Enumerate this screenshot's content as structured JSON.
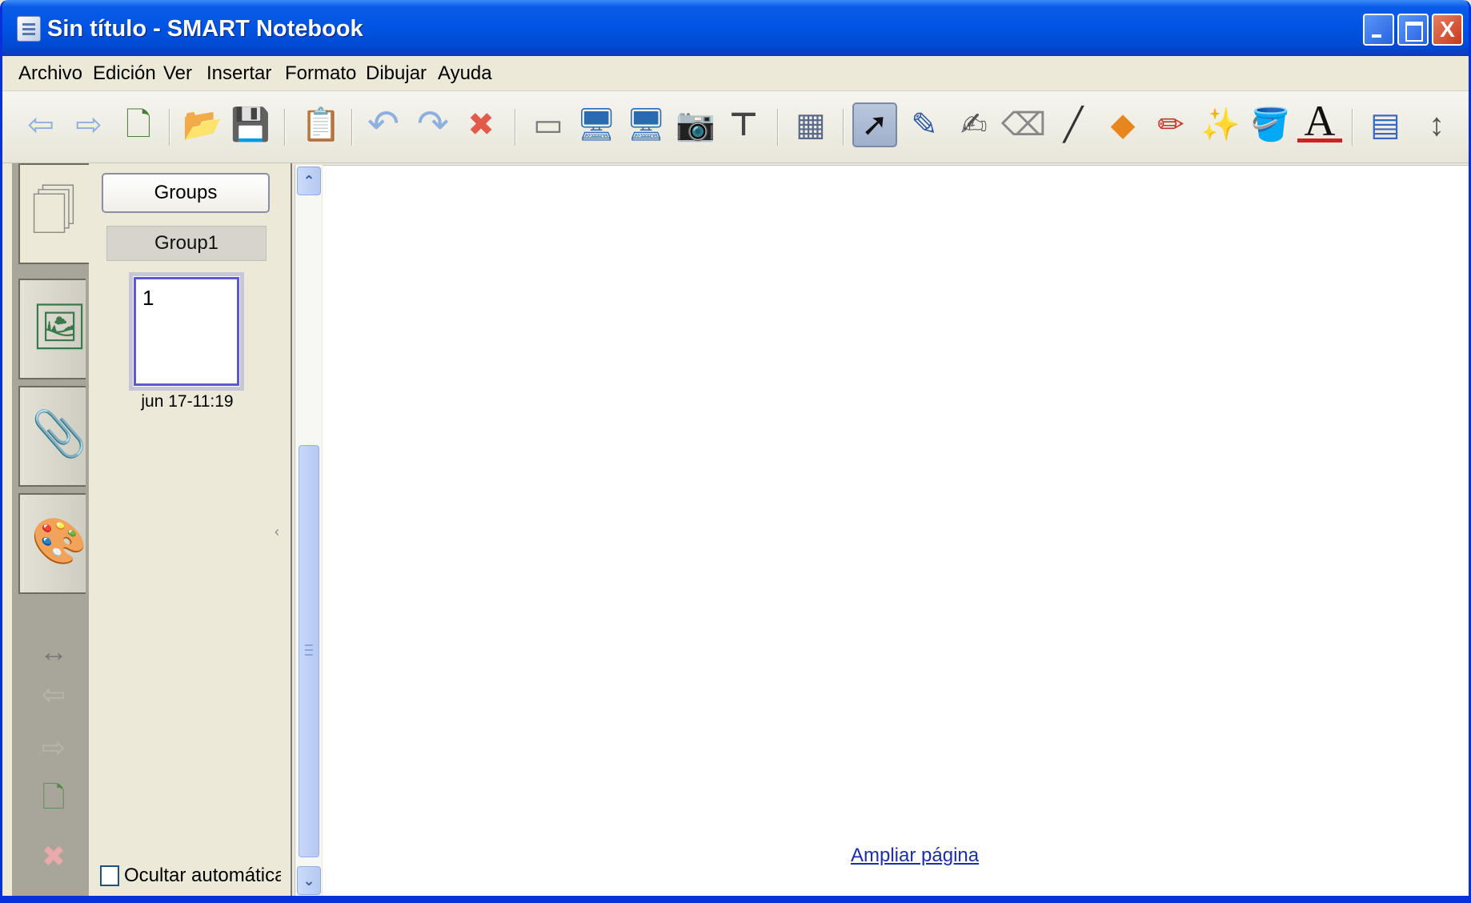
{
  "window": {
    "title": "Sin título - SMART Notebook",
    "controls": {
      "minimize": "minimize",
      "maximize": "maximize",
      "close": "X"
    }
  },
  "menu": {
    "items": [
      "Archivo",
      "Edición",
      "Ver",
      "Insertar",
      "Formato",
      "Dibujar",
      "Ayuda"
    ]
  },
  "toolbar": {
    "tools": [
      {
        "name": "back-arrow-icon",
        "glyph": "⇦"
      },
      {
        "name": "forward-arrow-icon",
        "glyph": "⇨"
      },
      {
        "name": "new-page-icon",
        "glyph": "🗋"
      },
      {
        "name": "open-folder-icon",
        "glyph": "📂"
      },
      {
        "name": "save-icon",
        "glyph": "💾"
      },
      {
        "name": "paste-icon",
        "glyph": "📋"
      },
      {
        "name": "undo-icon",
        "glyph": "↶"
      },
      {
        "name": "redo-icon",
        "glyph": "↷"
      },
      {
        "name": "delete-icon",
        "glyph": "✖"
      },
      {
        "name": "screen-shade-icon",
        "glyph": "▭"
      },
      {
        "name": "full-screen-icon",
        "glyph": "🖥"
      },
      {
        "name": "dual-page-icon",
        "glyph": "🖥"
      },
      {
        "name": "screen-capture-icon",
        "glyph": "📷"
      },
      {
        "name": "document-camera-icon",
        "glyph": "⊤"
      },
      {
        "name": "table-icon",
        "glyph": "▦"
      },
      {
        "name": "select-pointer-icon",
        "glyph": "➚"
      },
      {
        "name": "pen-icon",
        "glyph": "✎"
      },
      {
        "name": "creative-pen-icon",
        "glyph": "✍"
      },
      {
        "name": "eraser-icon",
        "glyph": "⌫"
      },
      {
        "name": "line-icon",
        "glyph": "╱"
      },
      {
        "name": "shapes-icon",
        "glyph": "◆"
      },
      {
        "name": "shape-recognition-pen-icon",
        "glyph": "✏"
      },
      {
        "name": "magic-pen-icon",
        "glyph": "✨"
      },
      {
        "name": "fill-icon",
        "glyph": "🪣"
      },
      {
        "name": "text-icon",
        "glyph": "A"
      },
      {
        "name": "properties-icon",
        "glyph": "▤"
      },
      {
        "name": "move-toolbar-icon",
        "glyph": "↕"
      }
    ]
  },
  "sidebar": {
    "tabs": [
      {
        "name": "page-sorter-tab",
        "glyph": "🗍"
      },
      {
        "name": "gallery-tab",
        "glyph": "🖼"
      },
      {
        "name": "attachments-tab",
        "glyph": "📎"
      },
      {
        "name": "properties-tab",
        "glyph": "🎨"
      }
    ],
    "nav": [
      {
        "name": "move-sidebar-icon",
        "glyph": "↔"
      },
      {
        "name": "previous-page-icon",
        "glyph": "⇦"
      },
      {
        "name": "next-page-icon",
        "glyph": "⇨"
      },
      {
        "name": "add-page-icon",
        "glyph": "🗋"
      },
      {
        "name": "delete-page-icon",
        "glyph": "✖"
      }
    ]
  },
  "sorter": {
    "groups_label": "Groups",
    "group_name": "Group1",
    "page_number": "1",
    "page_timestamp": "jun 17-11:19",
    "autohide_label": "Ocultar automáticamente"
  },
  "canvas": {
    "expand_link": "Ampliar página"
  },
  "colors": {
    "titlebar": "#0054e3",
    "chrome": "#ece9d8",
    "link": "#1c2ea8"
  }
}
